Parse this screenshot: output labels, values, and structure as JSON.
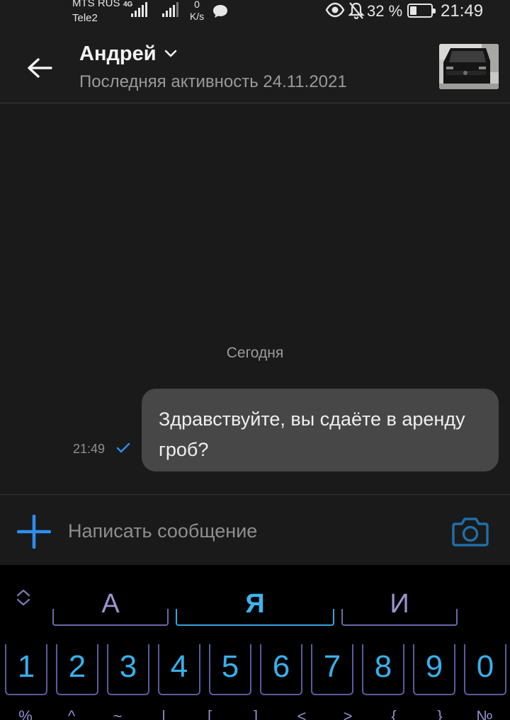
{
  "status_bar": {
    "carrier1": "MTS RUS",
    "carrier2": "Tele2",
    "network": "4G",
    "speed_value": "0",
    "speed_unit": "K/s",
    "battery_percent": "32 %",
    "battery_level": 0.32,
    "time": "21:49"
  },
  "header": {
    "contact_name": "Андрей",
    "last_seen": "Последняя активность 24.11.2021"
  },
  "chat": {
    "date_separator": "Сегодня",
    "messages": [
      {
        "text": "Здравствуйте, вы сдаёте в аренду гроб?",
        "time": "21:49",
        "status": "sent"
      }
    ]
  },
  "compose": {
    "placeholder": "Написать сообщение"
  },
  "keyboard": {
    "suggestions": [
      "А",
      "Я",
      "И"
    ],
    "numbers": [
      "1",
      "2",
      "3",
      "4",
      "5",
      "6",
      "7",
      "8",
      "9",
      "0"
    ],
    "symbols": [
      "%",
      "^",
      "~",
      "|",
      "[",
      "]",
      "<",
      ">",
      "{",
      "}",
      "№"
    ]
  },
  "colors": {
    "accent": "#2d8ff0",
    "bubble": "#474747",
    "background": "#1a1a1a",
    "keyboard_text": "#38b0ec",
    "keyboard_frame": "#5a5aa0"
  }
}
